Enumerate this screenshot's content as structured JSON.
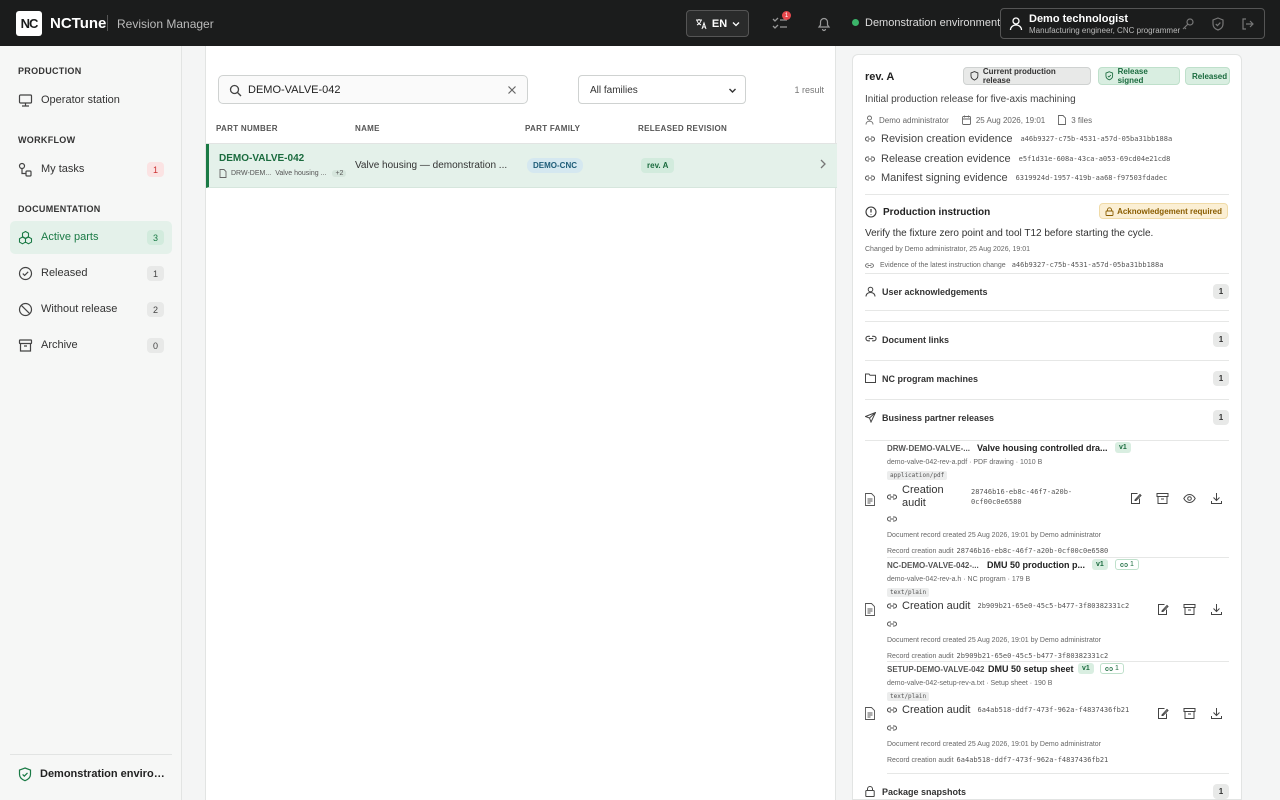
{
  "app": {
    "logo": "NC",
    "name": "NCTune",
    "module": "Revision Manager"
  },
  "topbar": {
    "language": "EN",
    "tasks_badge": "1",
    "environment": "Demonstration environment",
    "user": {
      "name": "Demo technologist",
      "role": "Manufacturing engineer, CNC programmer"
    }
  },
  "sidebar": {
    "sections": [
      {
        "heading": "PRODUCTION"
      },
      {
        "heading": "WORKFLOW"
      },
      {
        "heading": "DOCUMENTATION"
      }
    ],
    "items": [
      {
        "label": "Operator station",
        "count": ""
      },
      {
        "label": "My tasks",
        "count": "1"
      },
      {
        "label": "Active parts",
        "count": "3"
      },
      {
        "label": "Released",
        "count": "1"
      },
      {
        "label": "Without release",
        "count": "2"
      },
      {
        "label": "Archive",
        "count": "0"
      }
    ],
    "footer": "Demonstration environment"
  },
  "list": {
    "search_value": "DEMO-VALVE-042",
    "family_filter": "All families",
    "result_count": "1 result",
    "columns": [
      "PART NUMBER",
      "NAME",
      "PART FAMILY",
      "RELEASED REVISION"
    ],
    "rows": [
      {
        "part_number": "DEMO-VALVE-042",
        "doc_code": "DRW-DEM...",
        "doc_name": "Valve housing ...",
        "more": "+2",
        "name": "Valve housing — demonstration ...",
        "family": "DEMO-CNC",
        "revision": "rev. A"
      }
    ]
  },
  "detail": {
    "revision": "rev. A",
    "chips": [
      "Current production release",
      "Release signed",
      "Released"
    ],
    "description": "Initial production release for five-axis machining",
    "author": "Demo administrator",
    "date": "25 Aug 2026, 19:01",
    "files": "3 files",
    "evidence": [
      {
        "label": "Revision creation evidence",
        "hash": "a46b9327-c75b-4531-a57d-05ba31bb188a"
      },
      {
        "label": "Release creation evidence",
        "hash": "e5f1d31e-608a-43ca-a053-69cd04e21cd8"
      },
      {
        "label": "Manifest signing evidence",
        "hash": "6319924d-1957-419b-aa68-f97503fdadec"
      }
    ],
    "instruction": {
      "title": "Production instruction",
      "badge": "Acknowledgement required",
      "text": "Verify the fixture zero point and tool T12 before starting the cycle.",
      "changed": "Changed by Demo administrator, 25 Aug 2026, 19:01",
      "evidence_label": "Evidence of the latest instruction change",
      "evidence_hash": "a46b9327-c75b-4531-a57d-05ba31bb188a"
    },
    "sections": [
      {
        "label": "User acknowledgements",
        "count": "1"
      },
      {
        "label": "Document links",
        "count": "1"
      },
      {
        "label": "NC program machines",
        "count": "1"
      },
      {
        "label": "Business partner releases",
        "count": "1"
      },
      {
        "label": "Package snapshots",
        "count": "1"
      }
    ],
    "documents": [
      {
        "code": "DRW-DEMO-VALVE-...",
        "title": "Valve housing controlled dra...",
        "version": "v1",
        "links": "",
        "file": "demo-valve-042-rev-a.pdf · PDF drawing · 1010 B",
        "mime": "application/pdf",
        "audit_label": "Creation\naudit",
        "audit_hash": "28746b16-eb8c-46f7-a20b-0cf00c0e6580",
        "record": "Document record created 25 Aug 2026, 19:01 by Demo administrator",
        "record_audit_label": "Record creation audit",
        "record_audit_hash": "28746b16-eb8c-46f7-a20b-0cf00c0e6580"
      },
      {
        "code": "NC-DEMO-VALVE-042-...",
        "title": "DMU 50 production p...",
        "version": "v1",
        "links": "1",
        "file": "demo-valve-042-rev-a.h · NC program · 179 B",
        "mime": "text/plain",
        "audit_label": "Creation audit",
        "audit_hash": "2b909b21-65e0-45c5-b477-3f80382331c2",
        "record": "Document record created 25 Aug 2026, 19:01 by Demo administrator",
        "record_audit_label": "Record creation audit",
        "record_audit_hash": "2b909b21-65e0-45c5-b477-3f80382331c2"
      },
      {
        "code": "SETUP-DEMO-VALVE-042",
        "title": "DMU 50 setup sheet",
        "version": "v1",
        "links": "1",
        "file": "demo-valve-042-setup-rev-a.txt · Setup sheet · 190 B",
        "mime": "text/plain",
        "audit_label": "Creation audit",
        "audit_hash": "6a4ab518-ddf7-473f-962a-f4837436fb21",
        "record": "Document record created 25 Aug 2026, 19:01 by Demo administrator",
        "record_audit_label": "Record creation audit",
        "record_audit_hash": "6a4ab518-ddf7-473f-962a-f4837436fb21"
      }
    ]
  }
}
